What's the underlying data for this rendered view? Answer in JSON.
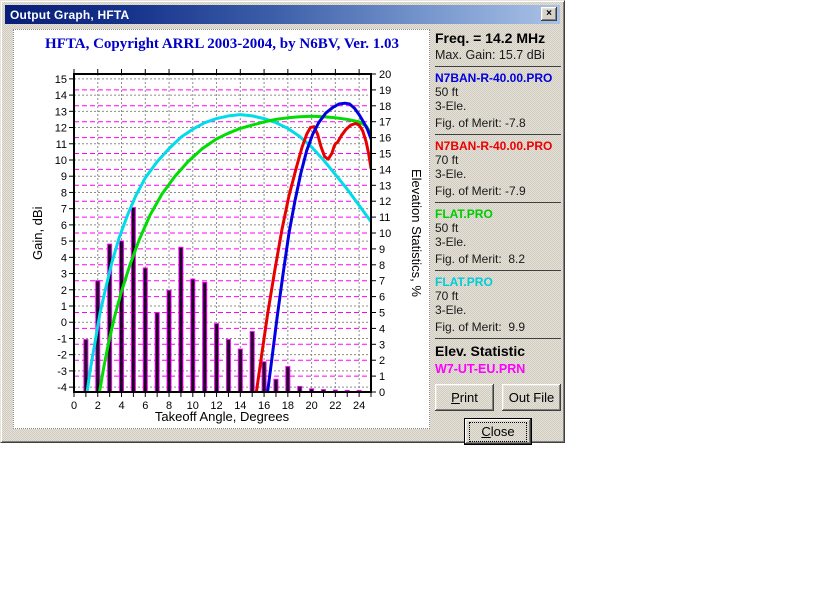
{
  "window": {
    "title": "Output Graph, HFTA",
    "close_glyph": "×"
  },
  "chart_data": {
    "type": "mixed-line-bar",
    "title": "HFTA, Copyright ARRL 2003-2004, by N6BV, Ver. 1.03",
    "xlabel": "Takeoff Angle, Degrees",
    "ylabel_left": "Gain, dBi",
    "ylabel_right": "Elevation Statistics, %",
    "x_min": 0,
    "x_max": 25,
    "x_tick_labels": [
      0,
      2,
      4,
      6,
      8,
      10,
      12,
      14,
      16,
      18,
      20,
      22,
      24
    ],
    "gain_box": [
      -4.3,
      15.3
    ],
    "pct_box": [
      0,
      20
    ],
    "gain_ticks": [
      -4,
      -3,
      -2,
      -1,
      0,
      1,
      2,
      3,
      4,
      5,
      6,
      7,
      8,
      9,
      10,
      11,
      12,
      13,
      14,
      15
    ],
    "pct_ticks": [
      0,
      1,
      2,
      3,
      4,
      5,
      6,
      7,
      8,
      9,
      10,
      11,
      12,
      13,
      14,
      15,
      16,
      17,
      18,
      19,
      20
    ],
    "grid_color": "#8c8c8c",
    "grid_pct_color": "#ff00ff",
    "grid_on": true,
    "bars": {
      "name": "W7-UT-EU.PRN",
      "axis": "right",
      "color": "#ff00ff",
      "fill": "#180020",
      "x": [
        1,
        2,
        3,
        4,
        5,
        6,
        7,
        8,
        9,
        10,
        11,
        12,
        13,
        14,
        15,
        16,
        17,
        18,
        19,
        20,
        21,
        22,
        23,
        24
      ],
      "values": [
        3.3,
        7.0,
        9.3,
        9.5,
        11.6,
        7.8,
        5.0,
        6.4,
        9.1,
        7.1,
        6.9,
        4.3,
        3.3,
        2.7,
        3.8,
        1.9,
        0.8,
        1.6,
        0.35,
        0.2,
        0.15,
        0.12,
        0.1,
        0.1
      ]
    },
    "series": [
      {
        "name": "N7BAN-R-40.00.PRO 50 ft",
        "color": "#0000e0",
        "points": [
          [
            16.3,
            -4.3
          ],
          [
            16.7,
            -2.0
          ],
          [
            17.1,
            0.3
          ],
          [
            17.6,
            3.0
          ],
          [
            18.1,
            5.5
          ],
          [
            18.6,
            7.5
          ],
          [
            19.1,
            9.2
          ],
          [
            19.6,
            10.6
          ],
          [
            20.1,
            11.6
          ],
          [
            20.6,
            12.3
          ],
          [
            21.2,
            12.9
          ],
          [
            21.8,
            13.25
          ],
          [
            22.3,
            13.45
          ],
          [
            22.8,
            13.5
          ],
          [
            23.2,
            13.45
          ],
          [
            23.6,
            13.2
          ],
          [
            24.0,
            12.8
          ],
          [
            24.4,
            12.3
          ],
          [
            24.7,
            11.9
          ],
          [
            25,
            11.3
          ]
        ]
      },
      {
        "name": "N7BAN-R-40.00.PRO 70 ft",
        "color": "#e80000",
        "points": [
          [
            15.35,
            -4.3
          ],
          [
            15.8,
            -2.0
          ],
          [
            16.3,
            0.5
          ],
          [
            16.9,
            3.2
          ],
          [
            17.5,
            5.7
          ],
          [
            18.1,
            7.8
          ],
          [
            18.7,
            9.5
          ],
          [
            19.2,
            10.8
          ],
          [
            19.6,
            11.6
          ],
          [
            19.9,
            12.0
          ],
          [
            20.2,
            12.05
          ],
          [
            20.5,
            11.6
          ],
          [
            20.8,
            10.8
          ],
          [
            21.1,
            10.2
          ],
          [
            21.4,
            10.05
          ],
          [
            21.7,
            10.4
          ],
          [
            21.9,
            10.85
          ],
          [
            22.0,
            11.0
          ],
          [
            22.2,
            11.1
          ],
          [
            22.5,
            11.5
          ],
          [
            22.9,
            11.9
          ],
          [
            23.3,
            12.15
          ],
          [
            23.7,
            12.25
          ],
          [
            24.0,
            12.15
          ],
          [
            24.3,
            11.8
          ],
          [
            24.6,
            11.1
          ],
          [
            24.8,
            10.4
          ],
          [
            25,
            9.5
          ]
        ]
      },
      {
        "name": "FLAT.PRO 50 ft",
        "color": "#00dd00",
        "points": [
          [
            2.15,
            -4.3
          ],
          [
            2.5,
            -2.8
          ],
          [
            2.9,
            -1.3
          ],
          [
            3.4,
            0.3
          ],
          [
            4,
            1.9
          ],
          [
            4.7,
            3.5
          ],
          [
            5.5,
            5.1
          ],
          [
            6.4,
            6.6
          ],
          [
            7.4,
            7.9
          ],
          [
            8.5,
            9.0
          ],
          [
            9.6,
            9.9
          ],
          [
            10.8,
            10.7
          ],
          [
            12,
            11.3
          ],
          [
            13,
            11.65
          ],
          [
            14,
            11.95
          ],
          [
            15,
            12.15
          ],
          [
            16,
            12.35
          ],
          [
            17,
            12.5
          ],
          [
            18,
            12.6
          ],
          [
            19,
            12.67
          ],
          [
            20,
            12.7
          ],
          [
            21,
            12.67
          ],
          [
            22,
            12.6
          ],
          [
            23,
            12.5
          ],
          [
            24,
            12.35
          ],
          [
            24.6,
            12.1
          ],
          [
            25,
            11.6
          ]
        ]
      },
      {
        "name": "FLAT.PRO 70 ft",
        "color": "#00dce8",
        "points": [
          [
            1.1,
            -4.3
          ],
          [
            1.4,
            -2.8
          ],
          [
            1.8,
            -1.1
          ],
          [
            2.2,
            0.6
          ],
          [
            2.7,
            2.2
          ],
          [
            3.2,
            3.7
          ],
          [
            3.8,
            5.2
          ],
          [
            4.5,
            6.6
          ],
          [
            5.2,
            7.8
          ],
          [
            6,
            8.9
          ],
          [
            7,
            9.9
          ],
          [
            8,
            10.7
          ],
          [
            9,
            11.4
          ],
          [
            10,
            11.9
          ],
          [
            11,
            12.3
          ],
          [
            12,
            12.55
          ],
          [
            13,
            12.72
          ],
          [
            14,
            12.8
          ],
          [
            15,
            12.72
          ],
          [
            16,
            12.55
          ],
          [
            17,
            12.3
          ],
          [
            18,
            11.95
          ],
          [
            19,
            11.45
          ],
          [
            20,
            10.8
          ],
          [
            21,
            10.0
          ],
          [
            22,
            9.1
          ],
          [
            23,
            8.2
          ],
          [
            24,
            7.2
          ],
          [
            25,
            6.2
          ]
        ]
      }
    ]
  },
  "info_panel": {
    "freq": "Freq. = 14.2 MHz",
    "max_gain": "Max. Gain: 15.7 dBi",
    "entries": [
      {
        "file": "N7BAN-R-40.00.PRO",
        "color": "#0000dd",
        "height": "50 ft",
        "elements": "3-Ele.",
        "merit": "Fig. of Merit: -7.8"
      },
      {
        "file": "N7BAN-R-40.00.PRO",
        "color": "#ee0000",
        "height": "70 ft",
        "elements": "3-Ele.",
        "merit": "Fig. of Merit: -7.9"
      },
      {
        "file": "FLAT.PRO",
        "color": "#00cc00",
        "height": "50 ft",
        "elements": "3-Ele.",
        "merit": "Fig. of Merit:  8.2"
      },
      {
        "file": "FLAT.PRO",
        "color": "#00ccd8",
        "height": "70 ft",
        "elements": "3-Ele.",
        "merit": "Fig. of Merit:  9.9"
      }
    ],
    "elev_title": "Elev. Statistic",
    "elev_file": "W7-UT-EU.PRN",
    "elev_color": "#ff00ff"
  },
  "buttons": {
    "print": "Print",
    "out_file": "Out File",
    "close": "Close"
  }
}
